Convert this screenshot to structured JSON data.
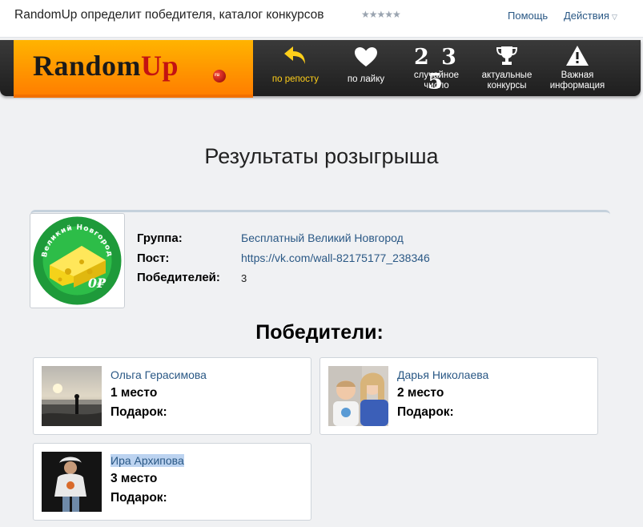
{
  "header": {
    "title": "RandomUp определит победителя, каталог конкурсов",
    "rating": "★★★★★",
    "help": "Помощь",
    "actions": "Действия"
  },
  "nav": {
    "logo_random": "Random",
    "logo_up": "Up",
    "logo_badge": "ru",
    "items": [
      {
        "label": "по репосту",
        "icon": "reply-arrow-icon",
        "active": true
      },
      {
        "label": "по лайку",
        "icon": "heart-icon"
      },
      {
        "number": "2 3 5",
        "label1": "случайное",
        "label2": "число"
      },
      {
        "label1": "актуальные",
        "label2": "конкурсы",
        "icon": "trophy-icon"
      },
      {
        "label1": "Важная",
        "label2": "информация",
        "icon": "warning-icon"
      }
    ],
    "active_color": "#ffcf1a"
  },
  "page": {
    "title": "Результаты розыгрыша"
  },
  "group": {
    "badge_top": "Великий Новгород",
    "badge_price": "0₽",
    "group_label": "Группа:",
    "group_value": "Бесплатный Великий Новгород",
    "post_label": "Пост:",
    "post_value": "https://vk.com/wall-82175177_238346",
    "winners_label": "Победителей:",
    "winners_value": "3"
  },
  "winners": {
    "title": "Победители:",
    "gift_label": "Подарок:",
    "items": [
      {
        "name": "Ольга Герасимова",
        "place": "1 место"
      },
      {
        "name": "Дарья Николаева",
        "place": "2 место"
      },
      {
        "name": "Ира Архипова",
        "place": "3 место"
      }
    ]
  }
}
